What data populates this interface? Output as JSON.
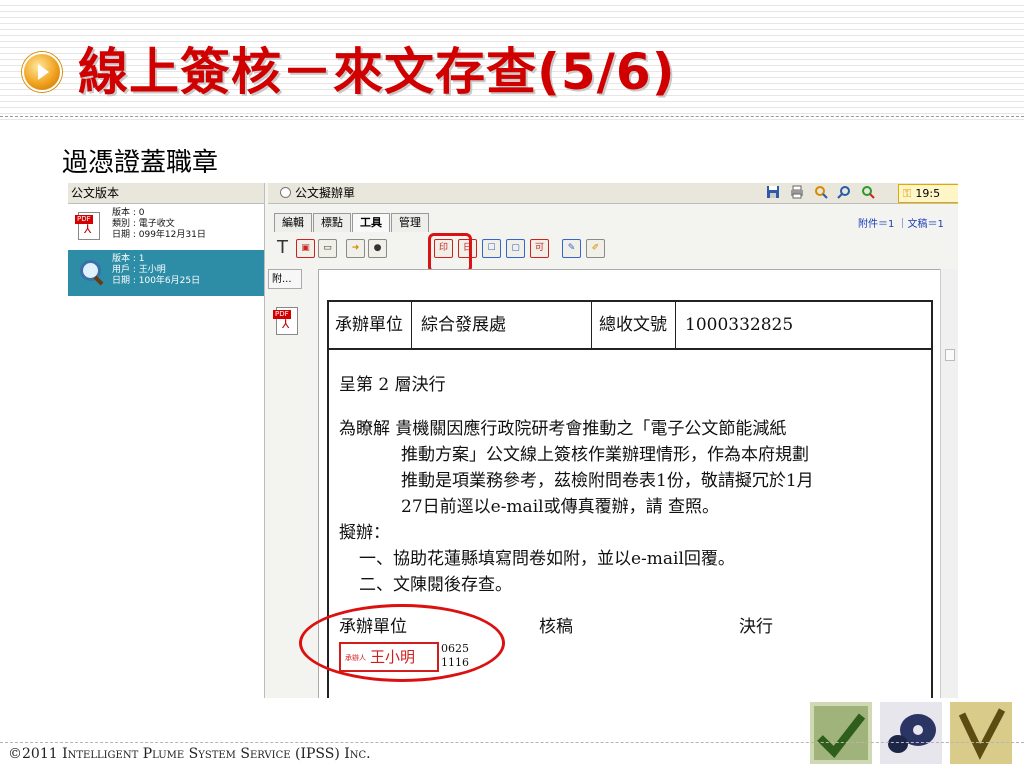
{
  "slide": {
    "title": "線上簽核－來文存查(5/6)",
    "subtitle": "過憑證蓋職章",
    "footer": "©2011 Intelligent Plume System Service (IPSS) Inc."
  },
  "colors": {
    "title": "#d10000",
    "accent": "#2d8ca6",
    "highlight": "#d91313"
  },
  "left_panel": {
    "header": "公文版本",
    "versions": [
      {
        "version": "版本 : 0",
        "type": "類別 : 電子收文",
        "date": "日期 : 099年12月31日",
        "icon": "pdf-icon"
      },
      {
        "version": "版本 : 1",
        "user": "用戶 : 王小明",
        "date": "日期 : 100年6月25日",
        "icon": "magnifier-icon"
      }
    ]
  },
  "right_panel": {
    "header": "公文擬辦單",
    "time": "19:5",
    "tabs": [
      "編輯",
      "標點",
      "工具",
      "管理"
    ],
    "active_tab": "工具",
    "attach_info": "附件＝1 ｜文稿＝1",
    "side_tab": "附..."
  },
  "document": {
    "unit_label": "承辦單位",
    "unit_value": "綜合發展處",
    "number_label": "總收文號",
    "number_value": "1000332825",
    "level_line": "呈第 2 層決行",
    "body_lines": [
      "為瞭解 貴機關因應行政院研考會推動之「電子公文節能減紙",
      "推動方案」公文線上簽核作業辦理情形，作為本府規劃",
      "推動是項業務參考，茲檢附問卷表1份，敬請擬冗於1月",
      "27日前逕以e-mail或傳真覆辦，請 查照。"
    ],
    "proposal_label": "擬辦：",
    "proposal_items": [
      "一、協助花蓮縣填寫問卷如附，並以e-mail回覆。",
      "二、文陳閱後存查。"
    ],
    "sign_labels": [
      "承辦單位",
      "核稿",
      "決行"
    ],
    "stamp_prefix": "承辦人",
    "stamp_name": "王小明",
    "stamp_codes": [
      "0625",
      "1116"
    ]
  }
}
